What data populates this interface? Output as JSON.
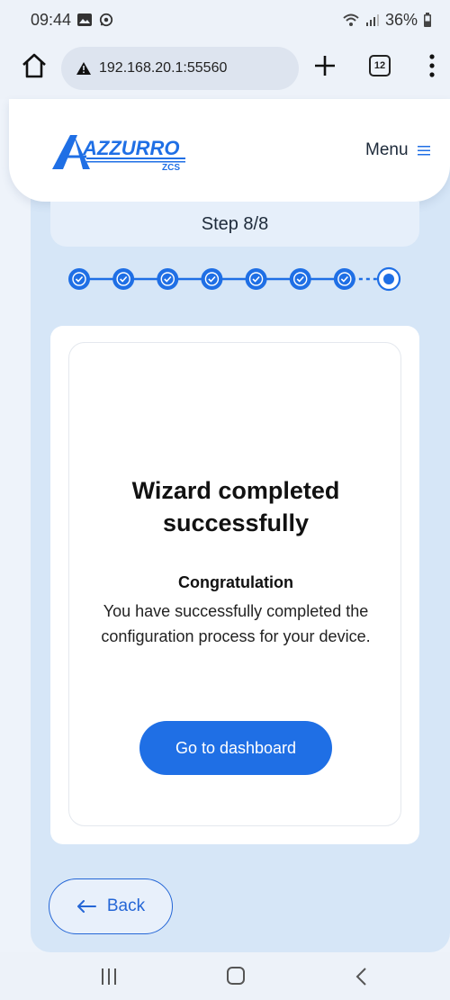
{
  "status_bar": {
    "time": "09:44",
    "battery": "36%",
    "icons": [
      "image-icon",
      "whatsapp-icon",
      "wifi-icon",
      "signal-icon",
      "battery-icon"
    ]
  },
  "browser": {
    "url": "192.168.20.1:55560",
    "tab_count": "12",
    "icons": [
      "home-icon",
      "warning-icon",
      "plus-icon",
      "tabs-icon",
      "more-vert-icon"
    ]
  },
  "header": {
    "logo_text": "AZZURRO",
    "logo_sub": "ZCS",
    "menu_label": "Menu"
  },
  "wizard": {
    "step_label": "Step 8/8",
    "total_steps": 8,
    "completed_steps": 7,
    "current_step": 8
  },
  "card": {
    "title": "Wizard completed successfully",
    "subtitle": "Congratulation",
    "message": "You have successfully completed the configuration process for your device.",
    "button_label": "Go to dashboard"
  },
  "footer": {
    "back_label": "Back"
  },
  "colors": {
    "accent": "#1f6fe5",
    "panel": "#d6e6f7",
    "step_done": "#1f6fe5"
  }
}
